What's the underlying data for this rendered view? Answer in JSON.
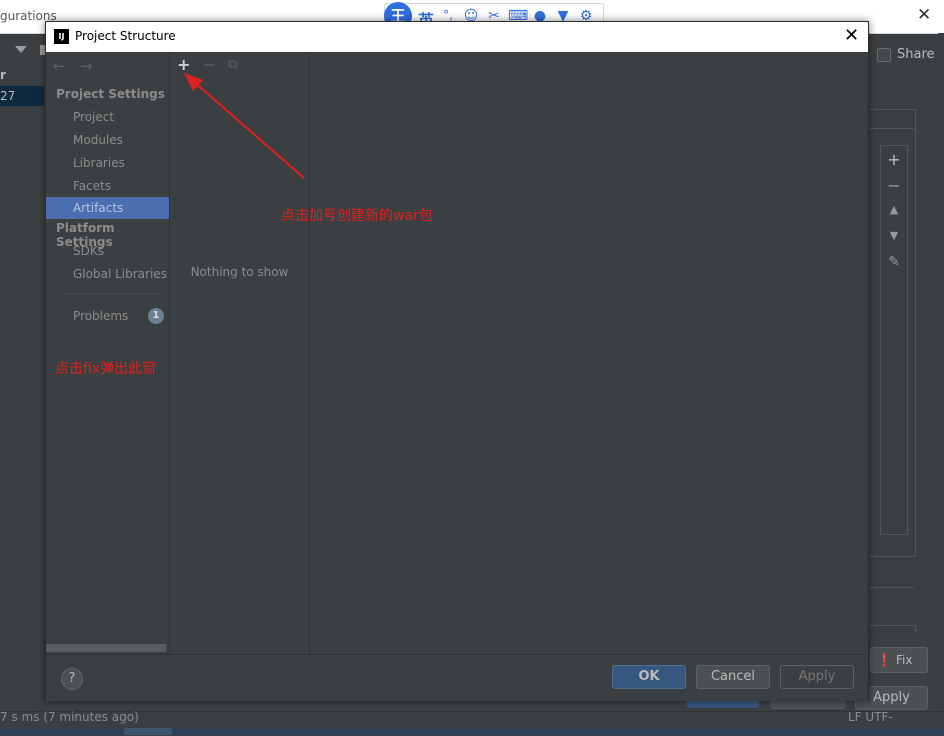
{
  "background_window": {
    "title_fragment": "gurations",
    "tree_header_fragment": "r",
    "tree_selected_fragment": "27",
    "share_label": "Share",
    "fix_label": "Fix",
    "apply_label": "Apply",
    "status_left_fragment": "7 s ms (7 minutes ago)",
    "status_right_fragment": "LF  UTF-"
  },
  "ime_toolbar": {
    "logo_char": "王",
    "lang_char": "英",
    "icons": [
      "punctuation-icon",
      "emoji-icon",
      "scissors-icon",
      "keyboard-icon",
      "user-icon",
      "shirt-icon",
      "settings-icon"
    ]
  },
  "dialog": {
    "title": "Project Structure",
    "close_glyph": "✕",
    "project_settings_header": "Project Settings",
    "project_settings_items": [
      "Project",
      "Modules",
      "Libraries",
      "Facets",
      "Artifacts"
    ],
    "selected_item": "Artifacts",
    "platform_settings_header": "Platform Settings",
    "platform_settings_items": [
      "SDKs",
      "Global Libraries"
    ],
    "problems_label": "Problems",
    "problems_count": "1",
    "empty_text": "Nothing to show",
    "help_glyph": "?",
    "ok_label": "OK",
    "cancel_label": "Cancel",
    "apply_label": "Apply"
  },
  "annotations": {
    "plus_hint": "点击加号创建新的war包",
    "fix_hint": "点击fix弹出此窗"
  },
  "colors": {
    "background": "#3c3f41",
    "selection": "#4b6eaf",
    "ok_button": "#365880",
    "annotation_red": "#e02020",
    "ime_blue": "#2f6fe0"
  }
}
